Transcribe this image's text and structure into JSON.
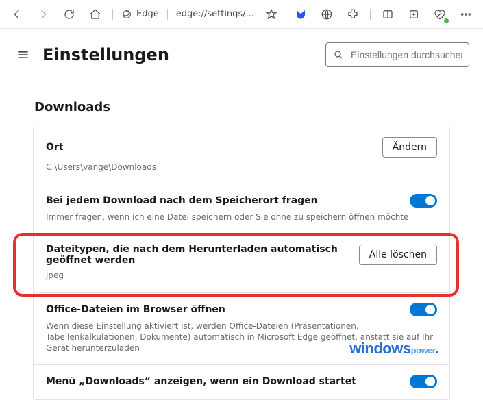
{
  "toolbar": {
    "site_label": "Edge",
    "url": "edge://settings/..."
  },
  "header": {
    "title": "Einstellungen",
    "search_placeholder": "Einstellungen durchsuchen"
  },
  "section": {
    "title": "Downloads"
  },
  "rows": {
    "location": {
      "label": "Ort",
      "value": "C:\\Users\\vange\\Downloads",
      "button": "Ändern"
    },
    "ask": {
      "label": "Bei jedem Download nach dem Speicherort fragen",
      "desc": "Immer fragen, wenn ich eine Datei speichern oder Sie ohne zu speichern öffnen möchte"
    },
    "autoopen": {
      "label": "Dateitypen, die nach dem Herunterladen automatisch geöffnet werden",
      "value": "jpeg",
      "button": "Alle löschen"
    },
    "office": {
      "label": "Office-Dateien im Browser öffnen",
      "desc": "Wenn diese Einstellung aktiviert ist, werden Office-Dateien (Präsentationen, Tabellenkalkulationen, Dokumente) automatisch in Microsoft Edge geöffnet, anstatt sie auf Ihr Gerät herunterzuladen"
    },
    "menu": {
      "label": "Menü „Downloads“ anzeigen, wenn ein Download startet"
    }
  },
  "watermark": {
    "part1": "windows",
    "part2": "power",
    "dot": "."
  }
}
